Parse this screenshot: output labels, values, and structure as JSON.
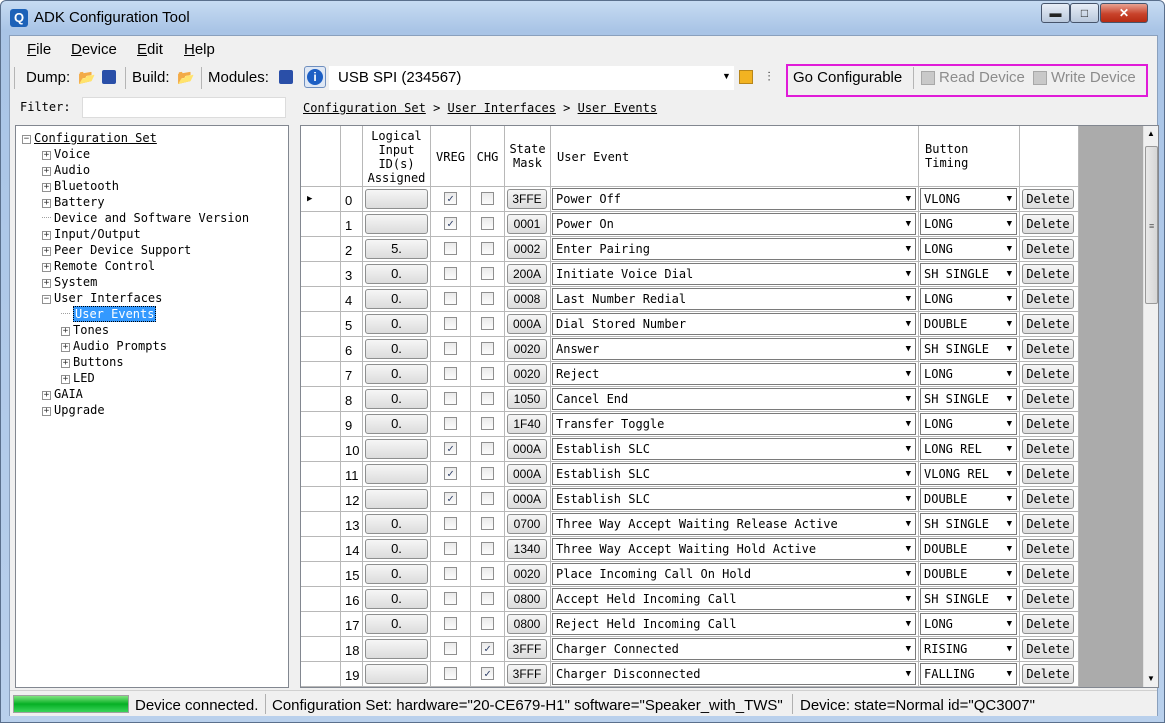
{
  "window": {
    "title": "ADK Configuration Tool",
    "app_icon": "Q",
    "minimize_glyph": "▬",
    "maximize_glyph": "□",
    "close_glyph": "✕"
  },
  "menu": [
    {
      "label": "File",
      "mnemonic": "F",
      "rest": "ile"
    },
    {
      "label": "Device",
      "mnemonic": "D",
      "rest": "evice"
    },
    {
      "label": "Edit",
      "mnemonic": "E",
      "rest": "dit"
    },
    {
      "label": "Help",
      "mnemonic": "H",
      "rest": "elp"
    }
  ],
  "toolbar": {
    "dump_label": "Dump:",
    "build_label": "Build:",
    "modules_label": "Modules:",
    "port_value": "USB SPI (234567)",
    "go_configurable": "Go Configurable",
    "read_device": "Read Device",
    "write_device": "Write Device",
    "icons": {
      "open": "📂",
      "save": "💾",
      "info": "i"
    }
  },
  "filter": {
    "label": "Filter:",
    "value": ""
  },
  "breadcrumb": [
    "Configuration Set",
    "User Interfaces",
    "User Events"
  ],
  "breadcrumb_separator": ">",
  "tree": {
    "root": "Configuration Set",
    "items": [
      {
        "label": "Voice",
        "level": 1,
        "expander": "+"
      },
      {
        "label": "Audio",
        "level": 1,
        "expander": "+"
      },
      {
        "label": "Bluetooth",
        "level": 1,
        "expander": "+"
      },
      {
        "label": "Battery",
        "level": 1,
        "expander": "+"
      },
      {
        "label": "Device and Software Version",
        "level": 1,
        "expander": ""
      },
      {
        "label": "Input/Output",
        "level": 1,
        "expander": "+"
      },
      {
        "label": "Peer Device Support",
        "level": 1,
        "expander": "+"
      },
      {
        "label": "Remote Control",
        "level": 1,
        "expander": "+"
      },
      {
        "label": "System",
        "level": 1,
        "expander": "+"
      },
      {
        "label": "User Interfaces",
        "level": 1,
        "expander": "−"
      },
      {
        "label": "User Events",
        "level": 2,
        "expander": "",
        "selected": true
      },
      {
        "label": "Tones",
        "level": 2,
        "expander": "+"
      },
      {
        "label": "Audio Prompts",
        "level": 2,
        "expander": "+"
      },
      {
        "label": "Buttons",
        "level": 2,
        "expander": "+"
      },
      {
        "label": "LED",
        "level": 2,
        "expander": "+"
      },
      {
        "label": "GAIA",
        "level": 1,
        "expander": "+"
      },
      {
        "label": "Upgrade",
        "level": 1,
        "expander": "+"
      }
    ]
  },
  "grid": {
    "columns": [
      "",
      "",
      "Logical Input ID(s) Assigned",
      "VREG",
      "CHG",
      "State Mask",
      "User Event",
      "Button Timing",
      ""
    ],
    "delete_label": "Delete",
    "rows": [
      {
        "idx": "0",
        "logical": "",
        "vreg": true,
        "chg": false,
        "mask": "3FFE",
        "event": "Power Off",
        "timing": "VLONG",
        "current": true
      },
      {
        "idx": "1",
        "logical": "",
        "vreg": true,
        "chg": false,
        "mask": "0001",
        "event": "Power On",
        "timing": "LONG"
      },
      {
        "idx": "2",
        "logical": "5.",
        "vreg": false,
        "chg": false,
        "mask": "0002",
        "event": "Enter Pairing",
        "timing": "LONG"
      },
      {
        "idx": "3",
        "logical": "0.",
        "vreg": false,
        "chg": false,
        "mask": "200A",
        "event": "Initiate Voice Dial",
        "timing": "SH SINGLE"
      },
      {
        "idx": "4",
        "logical": "0.",
        "vreg": false,
        "chg": false,
        "mask": "0008",
        "event": "Last Number Redial",
        "timing": "LONG"
      },
      {
        "idx": "5",
        "logical": "0.",
        "vreg": false,
        "chg": false,
        "mask": "000A",
        "event": "Dial Stored Number",
        "timing": "DOUBLE"
      },
      {
        "idx": "6",
        "logical": "0.",
        "vreg": false,
        "chg": false,
        "mask": "0020",
        "event": "Answer",
        "timing": "SH SINGLE"
      },
      {
        "idx": "7",
        "logical": "0.",
        "vreg": false,
        "chg": false,
        "mask": "0020",
        "event": "Reject",
        "timing": "LONG"
      },
      {
        "idx": "8",
        "logical": "0.",
        "vreg": false,
        "chg": false,
        "mask": "1050",
        "event": "Cancel End",
        "timing": "SH SINGLE"
      },
      {
        "idx": "9",
        "logical": "0.",
        "vreg": false,
        "chg": false,
        "mask": "1F40",
        "event": "Transfer Toggle",
        "timing": "LONG"
      },
      {
        "idx": "10",
        "logical": "",
        "vreg": true,
        "chg": false,
        "mask": "000A",
        "event": "Establish SLC",
        "timing": "LONG REL"
      },
      {
        "idx": "11",
        "logical": "",
        "vreg": true,
        "chg": false,
        "mask": "000A",
        "event": "Establish SLC",
        "timing": "VLONG REL"
      },
      {
        "idx": "12",
        "logical": "",
        "vreg": true,
        "chg": false,
        "mask": "000A",
        "event": "Establish SLC",
        "timing": "DOUBLE"
      },
      {
        "idx": "13",
        "logical": "0.",
        "vreg": false,
        "chg": false,
        "mask": "0700",
        "event": "Three Way Accept Waiting Release Active",
        "timing": "SH SINGLE"
      },
      {
        "idx": "14",
        "logical": "0.",
        "vreg": false,
        "chg": false,
        "mask": "1340",
        "event": "Three Way Accept Waiting Hold Active",
        "timing": "DOUBLE"
      },
      {
        "idx": "15",
        "logical": "0.",
        "vreg": false,
        "chg": false,
        "mask": "0020",
        "event": "Place Incoming Call On Hold",
        "timing": "DOUBLE"
      },
      {
        "idx": "16",
        "logical": "0.",
        "vreg": false,
        "chg": false,
        "mask": "0800",
        "event": "Accept Held Incoming Call",
        "timing": "SH SINGLE"
      },
      {
        "idx": "17",
        "logical": "0.",
        "vreg": false,
        "chg": false,
        "mask": "0800",
        "event": "Reject Held Incoming Call",
        "timing": "LONG"
      },
      {
        "idx": "18",
        "logical": "",
        "vreg": false,
        "chg": true,
        "mask": "3FFF",
        "event": "Charger Connected",
        "timing": "RISING"
      },
      {
        "idx": "19",
        "logical": "",
        "vreg": false,
        "chg": true,
        "mask": "3FFF",
        "event": "Charger Disconnected",
        "timing": "FALLING"
      }
    ]
  },
  "status": {
    "progress": 1.0,
    "connection": "Device connected.",
    "config_set": "Configuration Set:  hardware=\"20-CE679-H1\" software=\"Speaker_with_TWS\"",
    "device": "Device:  state=Normal id=\"QC3007\""
  },
  "colors": {
    "highlight_box": "#e01bd8",
    "selection": "#3399ff",
    "progress": "#06b025"
  }
}
